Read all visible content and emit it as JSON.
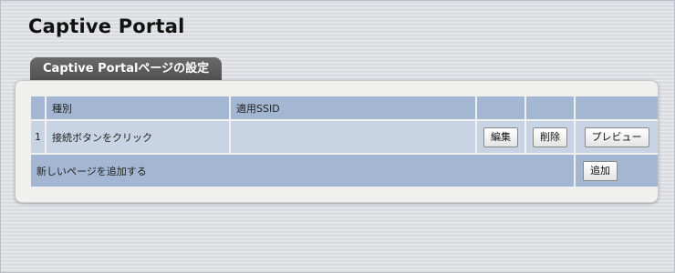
{
  "header": {
    "title": "Captive Portal"
  },
  "tab": {
    "label": "Captive Portalページの設定"
  },
  "table": {
    "columns": {
      "num": "",
      "type": "種別",
      "ssid": "適用SSID",
      "edit": "",
      "delete": "",
      "preview": ""
    },
    "rows": [
      {
        "num": "1",
        "type": "接続ボタンをクリック",
        "ssid": "",
        "edit_label": "編集",
        "delete_label": "削除",
        "preview_label": "プレビュー"
      }
    ],
    "add_row": {
      "label": "新しいページを追加する",
      "add_label": "追加"
    }
  },
  "colors": {
    "header_cell": "#a3b7d2",
    "body_cell": "#c8d3e3",
    "tab_bg": "#555555",
    "panel_bg": "#f0f0ee"
  }
}
